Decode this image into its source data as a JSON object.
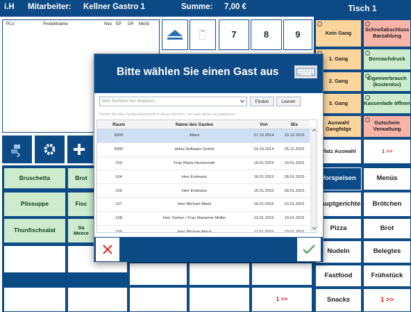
{
  "header": {
    "user": "i.H",
    "staff_label": "Mitarbeiter:",
    "staff_name": "Kellner Gastro 1",
    "sum_label": "Summe:",
    "sum_value": "7,00 €",
    "table_title": "Tisch 1"
  },
  "order_list": {
    "columns": [
      "PLU",
      "Produktname",
      "Neu",
      "EP",
      "GP",
      "MwSt"
    ]
  },
  "numpad": [
    "7",
    "8",
    "9"
  ],
  "products": {
    "rows": [
      [
        "Bruschetta",
        "Brot"
      ],
      [
        "Pilssuppe",
        "Fisc"
      ],
      [
        "Thunfischsalat",
        "Sa\nMeere"
      ]
    ],
    "more_label": "1 >>"
  },
  "right_panel": {
    "function_buttons": [
      [
        "Kein Gang",
        "Schnellabschluss Barzahlung"
      ],
      [
        "1. Gang",
        "Bonnachdruck"
      ],
      [
        "2. Gang",
        "Eigenverbrauch (kostenlos)"
      ],
      [
        "3. Gang",
        "Kassenlade öffnen"
      ],
      [
        "Auswahl Gangfolge",
        "Gutschein Verwaltung"
      ],
      [
        "Platz Auswahl",
        "1 >>"
      ]
    ],
    "categories": [
      [
        "Vorspeisen",
        "Menüs"
      ],
      [
        "Hauptgerichte",
        "Brötchen"
      ],
      [
        "Pizza",
        "Brot"
      ],
      [
        "Nudeln",
        "Belegtes"
      ],
      [
        "Fastfood",
        "Frühstück"
      ],
      [
        "Snacks",
        "1 >>"
      ]
    ]
  },
  "dialog": {
    "title": "Bitte wählen Sie einen Gast aus",
    "search_placeholder": "Bitte Suchtext hier eingeben...",
    "find_label": "Finden",
    "clear_label": "Leeren",
    "group_hint": "Ziehen Sie eine Spaltenüberschrift in diesen Bereich, um nach dieser zu gruppieren",
    "columns": [
      "Raum",
      "Name des Gastes",
      "Von",
      "Bis"
    ],
    "rows": [
      [
        "9000",
        "Allaut",
        "07.10.2014",
        "10.12.2015"
      ],
      [
        "9000",
        "deltra Software GmbH",
        "24.10.2014",
        "25.11.2015"
      ],
      [
        "103",
        "Frau Maria Heckenroth",
        "16.01.2015",
        "19.01.2015"
      ],
      [
        "104",
        "Herr Erdmann",
        "16.01.2015",
        "28.01.2015"
      ],
      [
        "106",
        "Herr Erdmann",
        "16.01.2015",
        "28.01.2015"
      ],
      [
        "107",
        "Herr Michael Abels",
        "16.01.2015",
        "22.01.2015"
      ],
      [
        "108",
        "Herr Gerber / Frau Marianne Müller",
        "13.01.2015",
        "19.01.2015"
      ],
      [
        "109",
        "Herr Michael Allaut",
        "11.01.2015",
        "19.01.2015"
      ]
    ]
  },
  "colors": {
    "navy": "#0c4a86",
    "green": "#cdeccd",
    "orange": "#fcd59c",
    "salmon": "#f9b4a8",
    "red": "#dd1111"
  }
}
